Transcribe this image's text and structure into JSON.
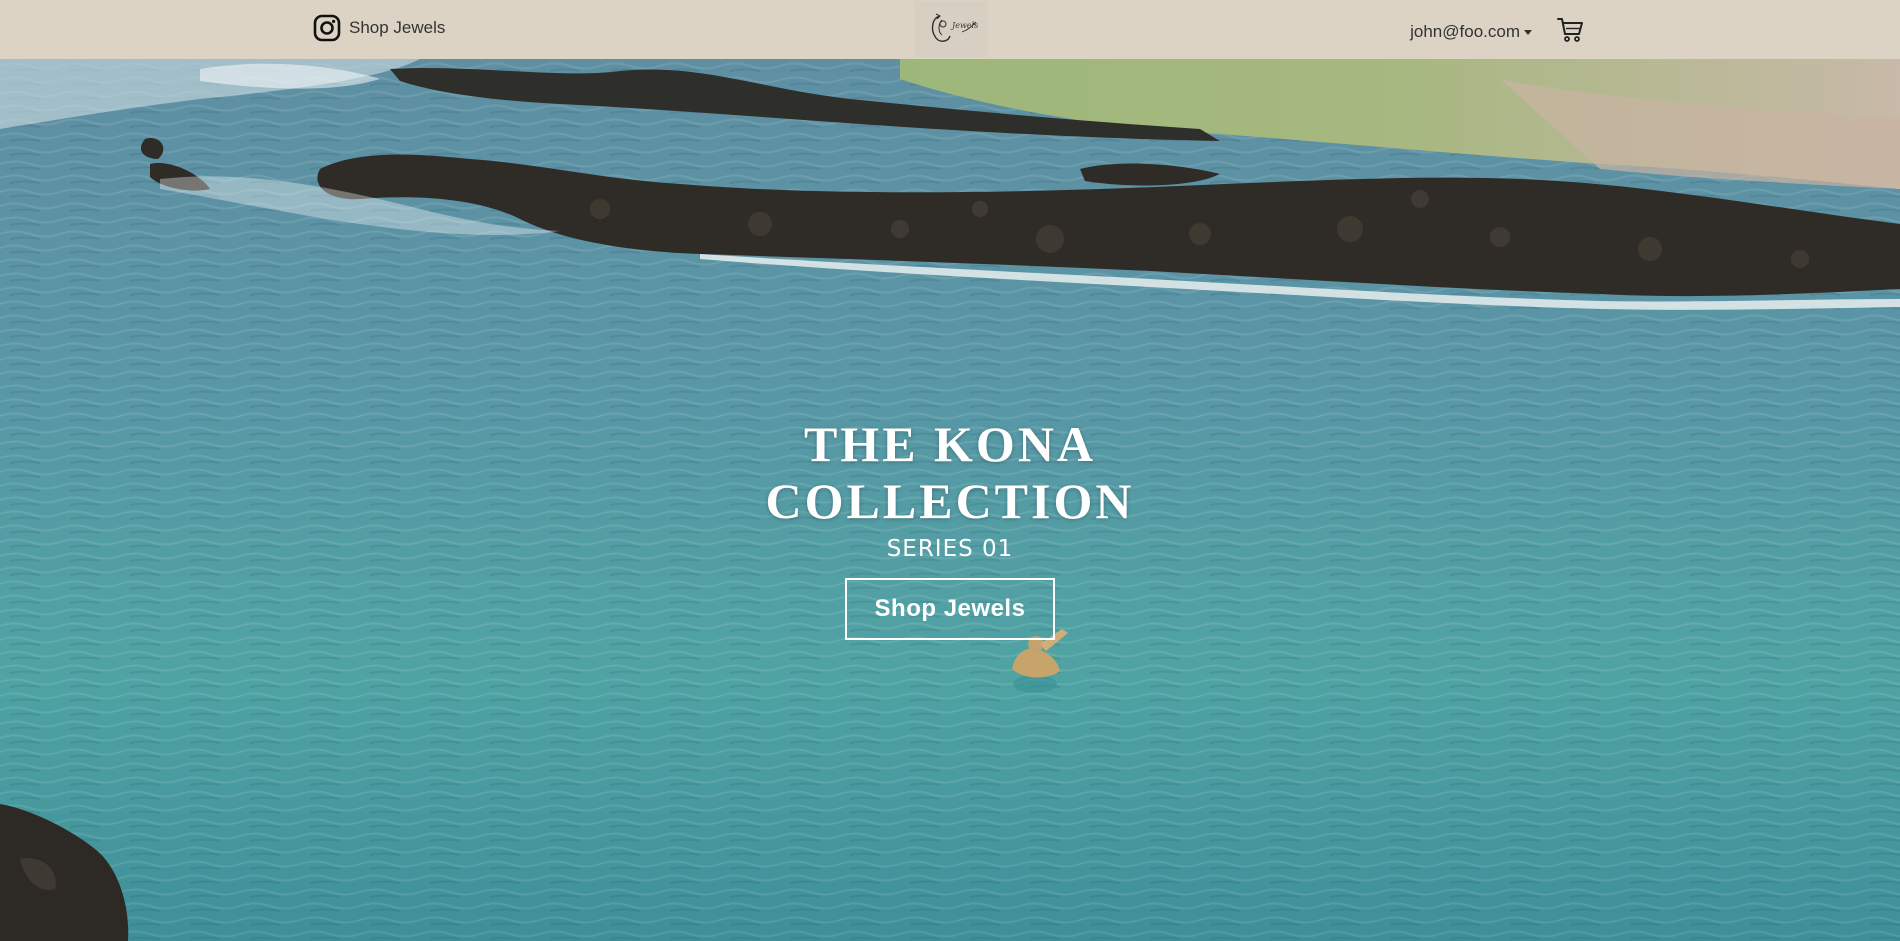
{
  "nav": {
    "instagram_icon": "instagram-icon",
    "shop_link": "Shop Jewels",
    "logo_text": "Jewels",
    "account_email": "john@foo.com",
    "cart_icon": "cart-icon"
  },
  "hero": {
    "title_line1": "THE KONA",
    "title_line2": "COLLECTION",
    "subtitle": "SERIES 01",
    "button_label": "Shop Jewels"
  },
  "colors": {
    "navbar_bg": "#dcd3c4",
    "nav_text": "#333333",
    "hero_text": "#ffffff"
  }
}
